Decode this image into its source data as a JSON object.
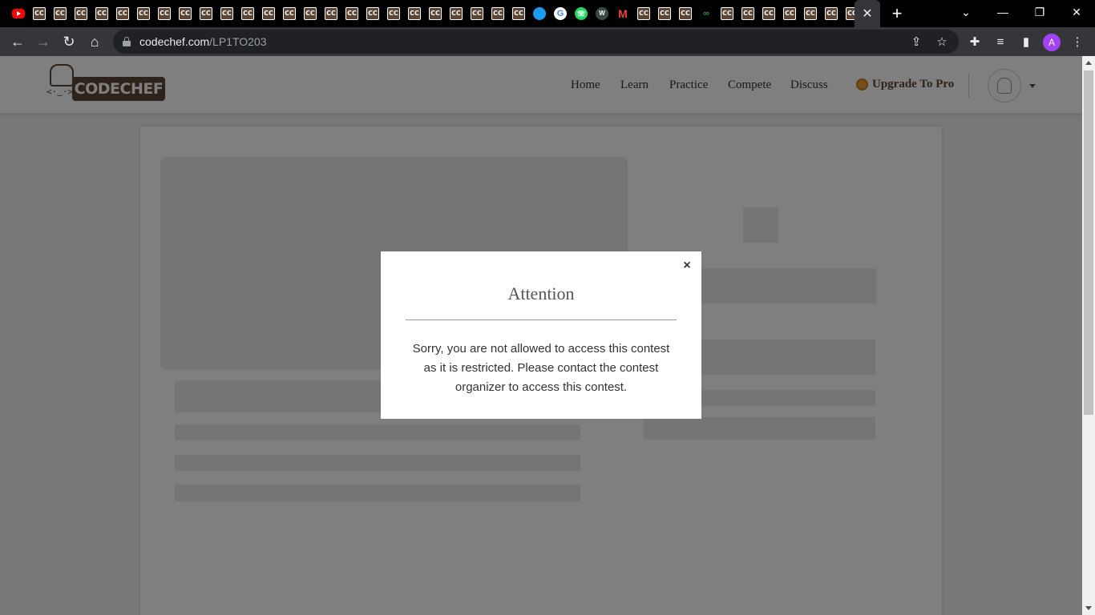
{
  "browser": {
    "tab_favicons": [
      "YouTube",
      "CC",
      "CC",
      "CC",
      "CC",
      "CC",
      "CC",
      "CC",
      "CC",
      "CC",
      "CC",
      "CC",
      "CC",
      "CC",
      "CC",
      "CC",
      "CC",
      "CC",
      "CC",
      "CC",
      "CC",
      "CC",
      "CC",
      "CC",
      "CC",
      "globe",
      "Google",
      "WhatsApp",
      "W",
      "Gmail",
      "CC",
      "CC",
      "CC",
      "GfG",
      "CC",
      "CC",
      "CC",
      "CC",
      "CC",
      "CC",
      "CC"
    ],
    "active_tab_close": "✕",
    "new_tab": "+",
    "window_controls": {
      "tab_search": "⌄",
      "minimize": "—",
      "restore": "❐",
      "close": "✕"
    },
    "address_bar": {
      "domain": "codechef.com",
      "path": "/LP1TO203"
    },
    "profile_initial": "A"
  },
  "site": {
    "logo_text": "CODECHEF",
    "logo_face": "<·‿·>",
    "nav": [
      "Home",
      "Learn",
      "Practice",
      "Compete",
      "Discuss"
    ],
    "upgrade_label": "Upgrade To Pro"
  },
  "modal": {
    "title": "Attention",
    "close": "×",
    "message": "Sorry, you are not allowed to access this contest as it is restricted. Please contact the contest organizer to access this contest."
  },
  "colors": {
    "brand": "#5b4636",
    "browser_frame": "#000000",
    "toolbar": "#35363a",
    "overlay": "rgba(0,0,0,0.5)"
  }
}
